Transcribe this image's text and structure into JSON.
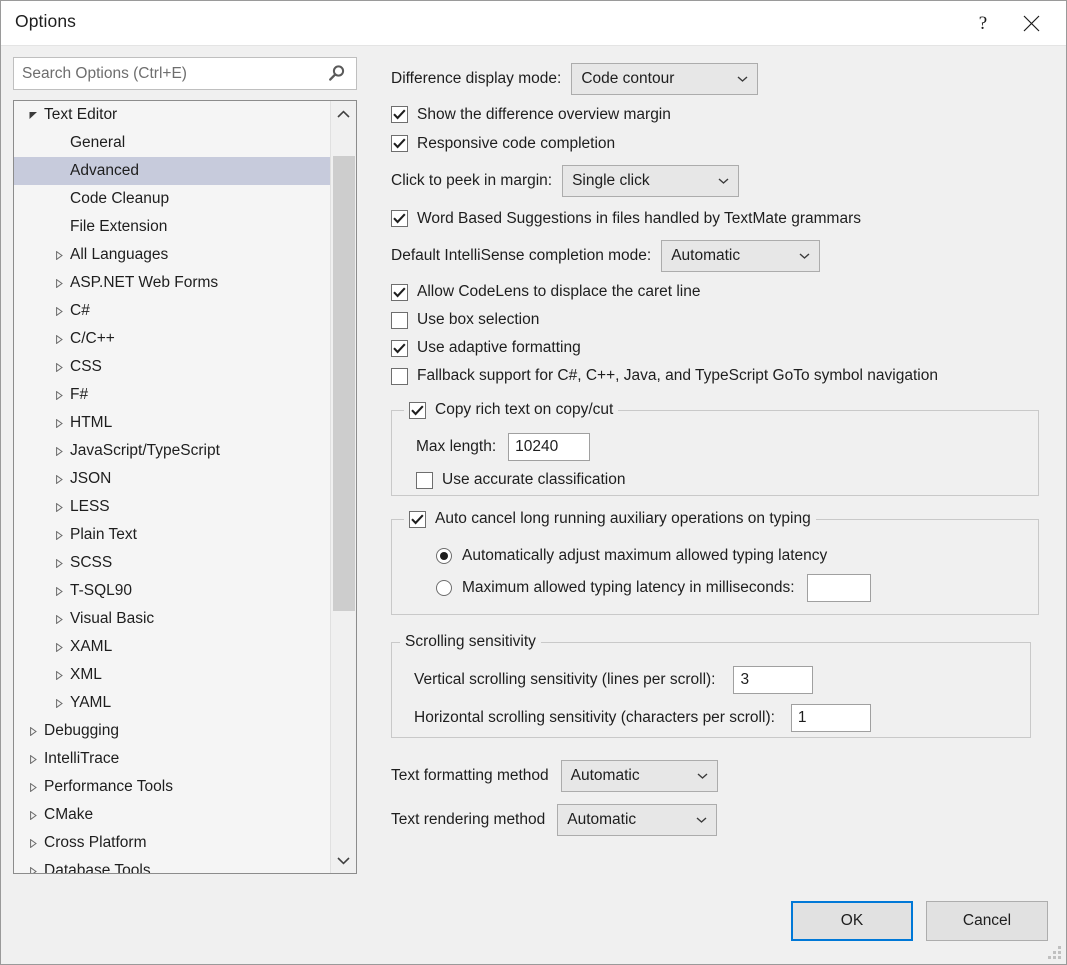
{
  "window": {
    "title": "Options",
    "help_label": "?",
    "close_label": "✕"
  },
  "search": {
    "placeholder": "Search Options (Ctrl+E)",
    "value": "",
    "icon": "search-icon"
  },
  "tree": {
    "selected": "Advanced",
    "items": [
      {
        "label": "Text Editor",
        "indent": 0,
        "arrow": "expanded",
        "selected": false
      },
      {
        "label": "General",
        "indent": 1,
        "arrow": "none",
        "selected": false
      },
      {
        "label": "Advanced",
        "indent": 1,
        "arrow": "none",
        "selected": true
      },
      {
        "label": "Code Cleanup",
        "indent": 1,
        "arrow": "none",
        "selected": false
      },
      {
        "label": "File Extension",
        "indent": 1,
        "arrow": "none",
        "selected": false
      },
      {
        "label": "All Languages",
        "indent": 1,
        "arrow": "collapsed",
        "selected": false
      },
      {
        "label": "ASP.NET Web Forms",
        "indent": 1,
        "arrow": "collapsed",
        "selected": false
      },
      {
        "label": "C#",
        "indent": 1,
        "arrow": "collapsed",
        "selected": false
      },
      {
        "label": "C/C++",
        "indent": 1,
        "arrow": "collapsed",
        "selected": false
      },
      {
        "label": "CSS",
        "indent": 1,
        "arrow": "collapsed",
        "selected": false
      },
      {
        "label": "F#",
        "indent": 1,
        "arrow": "collapsed",
        "selected": false
      },
      {
        "label": "HTML",
        "indent": 1,
        "arrow": "collapsed",
        "selected": false
      },
      {
        "label": "JavaScript/TypeScript",
        "indent": 1,
        "arrow": "collapsed",
        "selected": false
      },
      {
        "label": "JSON",
        "indent": 1,
        "arrow": "collapsed",
        "selected": false
      },
      {
        "label": "LESS",
        "indent": 1,
        "arrow": "collapsed",
        "selected": false
      },
      {
        "label": "Plain Text",
        "indent": 1,
        "arrow": "collapsed",
        "selected": false
      },
      {
        "label": "SCSS",
        "indent": 1,
        "arrow": "collapsed",
        "selected": false
      },
      {
        "label": "T-SQL90",
        "indent": 1,
        "arrow": "collapsed",
        "selected": false
      },
      {
        "label": "Visual Basic",
        "indent": 1,
        "arrow": "collapsed",
        "selected": false
      },
      {
        "label": "XAML",
        "indent": 1,
        "arrow": "collapsed",
        "selected": false
      },
      {
        "label": "XML",
        "indent": 1,
        "arrow": "collapsed",
        "selected": false
      },
      {
        "label": "YAML",
        "indent": 1,
        "arrow": "collapsed",
        "selected": false
      },
      {
        "label": "Debugging",
        "indent": 0,
        "arrow": "collapsed",
        "selected": false
      },
      {
        "label": "IntelliTrace",
        "indent": 0,
        "arrow": "collapsed",
        "selected": false
      },
      {
        "label": "Performance Tools",
        "indent": 0,
        "arrow": "collapsed",
        "selected": false
      },
      {
        "label": "CMake",
        "indent": 0,
        "arrow": "collapsed",
        "selected": false
      },
      {
        "label": "Cross Platform",
        "indent": 0,
        "arrow": "collapsed",
        "selected": false
      },
      {
        "label": "Database Tools",
        "indent": 0,
        "arrow": "collapsed",
        "selected": false
      }
    ]
  },
  "settings": {
    "difference_display_mode": {
      "label": "Difference display mode:",
      "value": "Code contour"
    },
    "show_difference_overview_margin": {
      "label": "Show the difference overview margin",
      "checked": true
    },
    "responsive_code_completion": {
      "label": "Responsive code completion",
      "checked": true
    },
    "click_to_peek_in_margin": {
      "label": "Click to peek in margin:",
      "value": "Single click"
    },
    "word_based_suggestions": {
      "label": "Word Based Suggestions in files handled by TextMate grammars",
      "checked": true
    },
    "default_intellisense_completion_mode": {
      "label": "Default IntelliSense completion mode:",
      "value": "Automatic"
    },
    "allow_codelens": {
      "label": "Allow CodeLens to displace the caret line",
      "checked": true
    },
    "use_box_selection": {
      "label": "Use box selection",
      "checked": false
    },
    "use_adaptive_formatting": {
      "label": "Use adaptive formatting",
      "checked": true
    },
    "fallback_support": {
      "label": "Fallback support for C#, C++, Java, and TypeScript GoTo symbol navigation",
      "checked": false
    },
    "copy_rich_text_group": {
      "caption": "Copy rich text on copy/cut",
      "checked": true,
      "max_length_label": "Max length:",
      "max_length_value": "10240",
      "use_accurate_classification_label": "Use accurate classification",
      "use_accurate_classification_checked": false
    },
    "auto_cancel_group": {
      "caption": "Auto cancel long running auxiliary operations on typing",
      "checked": true,
      "radio_auto_label": "Automatically adjust maximum allowed typing latency",
      "radio_auto_selected": true,
      "radio_manual_label": "Maximum allowed typing latency in milliseconds:",
      "radio_manual_selected": false,
      "latency_value": ""
    },
    "scrolling_group": {
      "caption": "Scrolling sensitivity",
      "vertical_label": "Vertical scrolling sensitivity (lines per scroll):",
      "vertical_value": "3",
      "horizontal_label": "Horizontal scrolling sensitivity (characters per scroll):",
      "horizontal_value": "1"
    },
    "text_formatting_method": {
      "label": "Text formatting method",
      "value": "Automatic"
    },
    "text_rendering_method": {
      "label": "Text rendering method",
      "value": "Automatic"
    }
  },
  "footer": {
    "ok_label": "OK",
    "cancel_label": "Cancel"
  },
  "colors": {
    "accent": "#0078D7",
    "selection": "#C7CBDC",
    "dialog_bg": "#F0F0F0"
  }
}
